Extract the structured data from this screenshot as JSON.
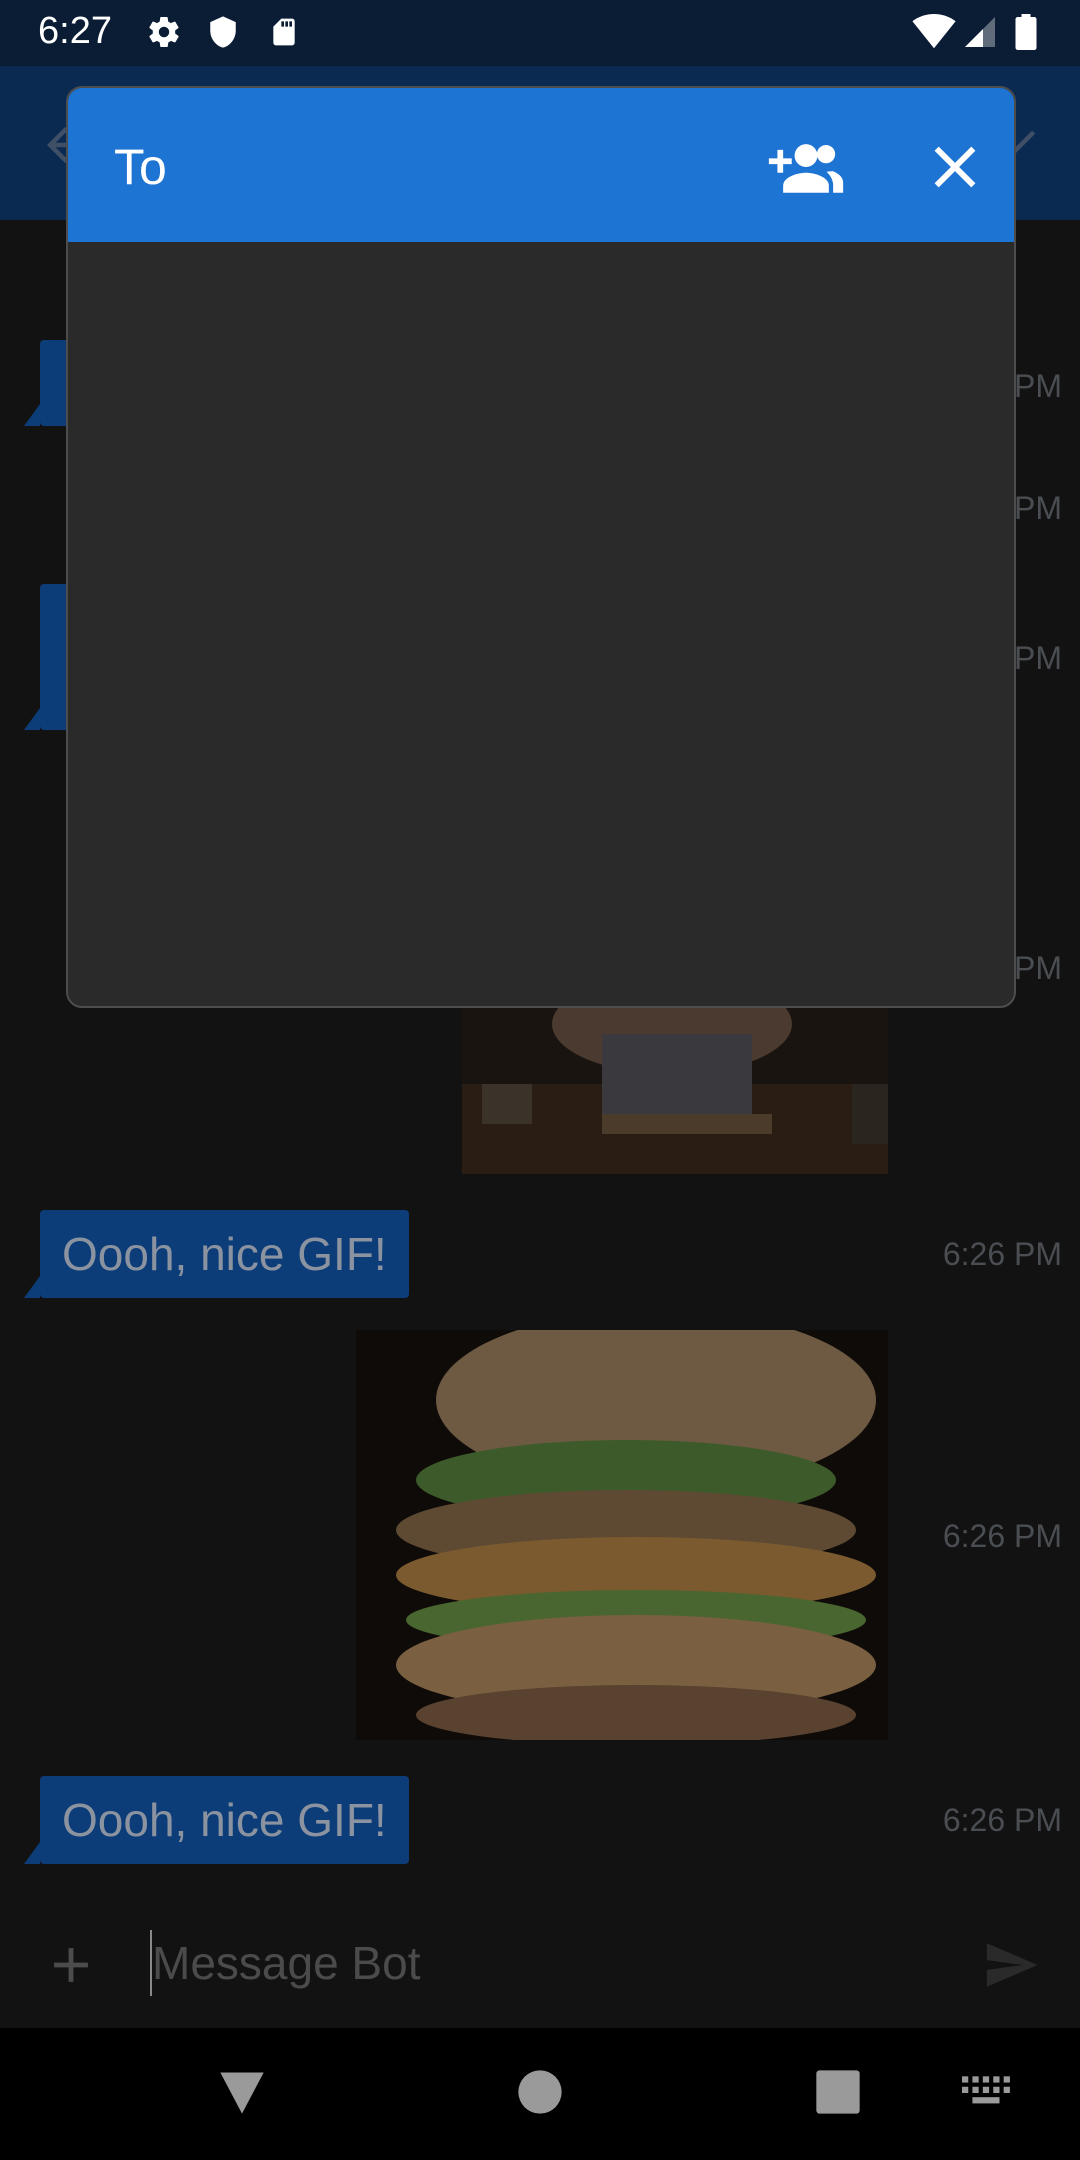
{
  "status_bar": {
    "time": "6:27"
  },
  "dialog": {
    "title": "To"
  },
  "chat": {
    "messages": [
      {
        "text": "Oooh, nice GIF!",
        "time": "6:26 PM"
      },
      {
        "text": "Oooh, nice GIF!",
        "time": "6:26 PM"
      }
    ],
    "hidden_times": [
      "PM",
      "PM",
      "PM",
      "PM"
    ],
    "gif_time": "6:26 PM"
  },
  "composer": {
    "placeholder": "Message Bot"
  }
}
